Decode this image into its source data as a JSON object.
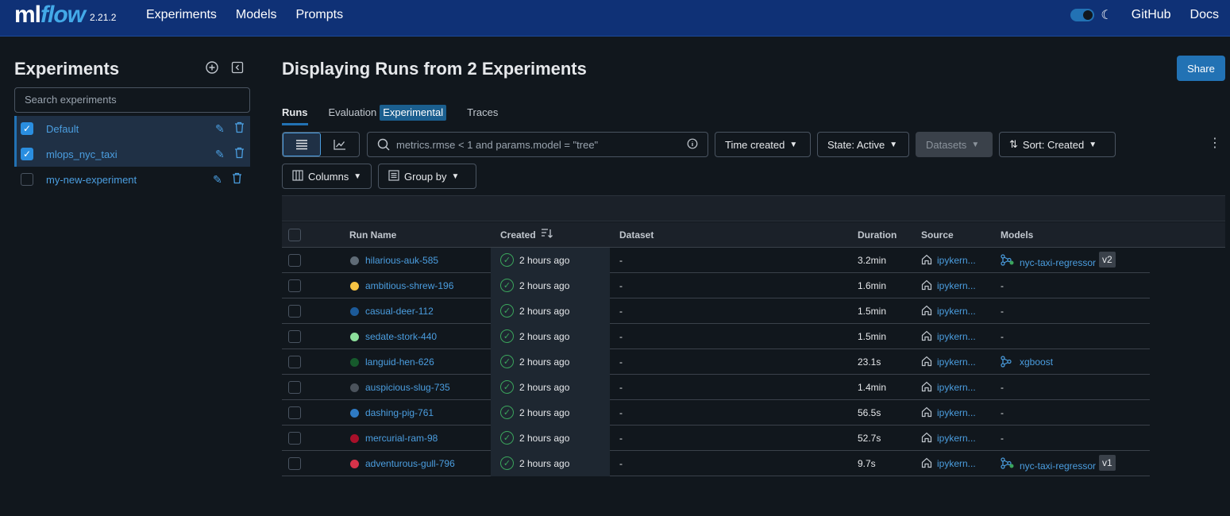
{
  "header": {
    "logo_ml": "ml",
    "logo_flow": "flow",
    "version": "2.21.2",
    "nav": [
      "Experiments",
      "Models",
      "Prompts"
    ],
    "links": [
      "GitHub",
      "Docs"
    ]
  },
  "sidebar": {
    "title": "Experiments",
    "search_placeholder": "Search experiments",
    "experiments": [
      {
        "name": "Default",
        "checked": true
      },
      {
        "name": "mlops_nyc_taxi",
        "checked": true
      },
      {
        "name": "my-new-experiment",
        "checked": false
      }
    ]
  },
  "main": {
    "title": "Displaying Runs from 2 Experiments",
    "share_label": "Share",
    "tabs": {
      "runs": "Runs",
      "evaluation": "Evaluation",
      "experimental": "Experimental",
      "traces": "Traces"
    },
    "search_placeholder": "metrics.rmse < 1 and params.model = \"tree\"",
    "filters": {
      "time": "Time created",
      "state": "State: Active",
      "datasets": "Datasets",
      "sort": "Sort: Created",
      "columns": "Columns",
      "group_by": "Group by"
    }
  },
  "table": {
    "headers": {
      "run_name": "Run Name",
      "created": "Created",
      "dataset": "Dataset",
      "duration": "Duration",
      "source": "Source",
      "models": "Models"
    },
    "rows": [
      {
        "name": "hilarious-auk-585",
        "color": "#5f6b76",
        "created": "2 hours ago",
        "dataset": "-",
        "duration": "3.2min",
        "source": "ipykern...",
        "model": "nyc-taxi-regressor",
        "version": "v2"
      },
      {
        "name": "ambitious-shrew-196",
        "color": "#f6c344",
        "created": "2 hours ago",
        "dataset": "-",
        "duration": "1.6min",
        "source": "ipykern...",
        "model": "-",
        "version": ""
      },
      {
        "name": "casual-deer-112",
        "color": "#1c5a99",
        "created": "2 hours ago",
        "dataset": "-",
        "duration": "1.5min",
        "source": "ipykern...",
        "model": "-",
        "version": ""
      },
      {
        "name": "sedate-stork-440",
        "color": "#8ddf9c",
        "created": "2 hours ago",
        "dataset": "-",
        "duration": "1.5min",
        "source": "ipykern...",
        "model": "-",
        "version": ""
      },
      {
        "name": "languid-hen-626",
        "color": "#165a2c",
        "created": "2 hours ago",
        "dataset": "-",
        "duration": "23.1s",
        "source": "ipykern...",
        "model": "xgboost",
        "version": ""
      },
      {
        "name": "auspicious-slug-735",
        "color": "#4b535c",
        "created": "2 hours ago",
        "dataset": "-",
        "duration": "1.4min",
        "source": "ipykern...",
        "model": "-",
        "version": ""
      },
      {
        "name": "dashing-pig-761",
        "color": "#2f7bc4",
        "created": "2 hours ago",
        "dataset": "-",
        "duration": "56.5s",
        "source": "ipykern...",
        "model": "-",
        "version": ""
      },
      {
        "name": "mercurial-ram-98",
        "color": "#a8102a",
        "created": "2 hours ago",
        "dataset": "-",
        "duration": "52.7s",
        "source": "ipykern...",
        "model": "-",
        "version": ""
      },
      {
        "name": "adventurous-gull-796",
        "color": "#d6334a",
        "created": "2 hours ago",
        "dataset": "-",
        "duration": "9.7s",
        "source": "ipykern...",
        "model": "nyc-taxi-regressor",
        "version": "v1"
      }
    ]
  }
}
